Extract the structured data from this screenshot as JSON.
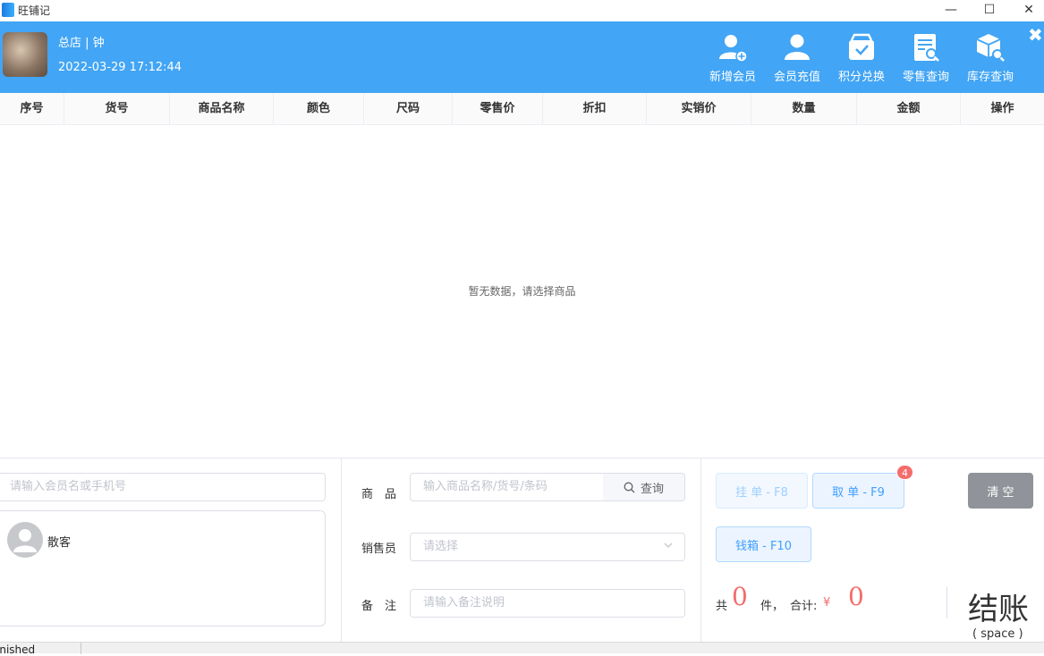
{
  "window": {
    "title": "旺铺记",
    "minimize": "—",
    "maximize": "☐",
    "close": "✕"
  },
  "header": {
    "shop": "总店 | 钟",
    "datetime": "2022-03-29 17:12:44",
    "actions": [
      {
        "label": "新增会员",
        "icon": "add-member-icon"
      },
      {
        "label": "会员充值",
        "icon": "member-icon"
      },
      {
        "label": "积分兑换",
        "icon": "points-exchange-icon"
      },
      {
        "label": "零售查询",
        "icon": "retail-query-icon"
      },
      {
        "label": "库存查询",
        "icon": "inventory-query-icon"
      }
    ],
    "close": "✖"
  },
  "table": {
    "columns": [
      "序号",
      "货号",
      "商品名称",
      "颜色",
      "尺码",
      "零售价",
      "折扣",
      "实销价",
      "数量",
      "金额",
      "操作"
    ],
    "empty": "暂无数据，请选择商品"
  },
  "member": {
    "search_placeholder": "请输入会员名或手机号",
    "name": "散客"
  },
  "form": {
    "product_label": "商　品",
    "product_placeholder": "输入商品名称/货号/条码",
    "search_btn": "查询",
    "seller_label": "销售员",
    "seller_placeholder": "请选择",
    "note_label": "备　注",
    "note_placeholder": "请输入备注说明"
  },
  "actions": {
    "hold": "挂 单 - F8",
    "retrieve": "取 单 - F9",
    "retrieve_badge": "4",
    "cashbox": "钱箱 - F10",
    "clear": "清 空"
  },
  "summary": {
    "prefix": "共",
    "count": "0",
    "unit": "件，",
    "total_label": "合计:",
    "currency": "¥",
    "total": "0",
    "checkout": "结账",
    "checkout_key": "( space )"
  },
  "status": {
    "text": "inished"
  },
  "colors": {
    "primary": "#42a5f5",
    "danger": "#f56c6c",
    "gray_btn": "#909399"
  }
}
